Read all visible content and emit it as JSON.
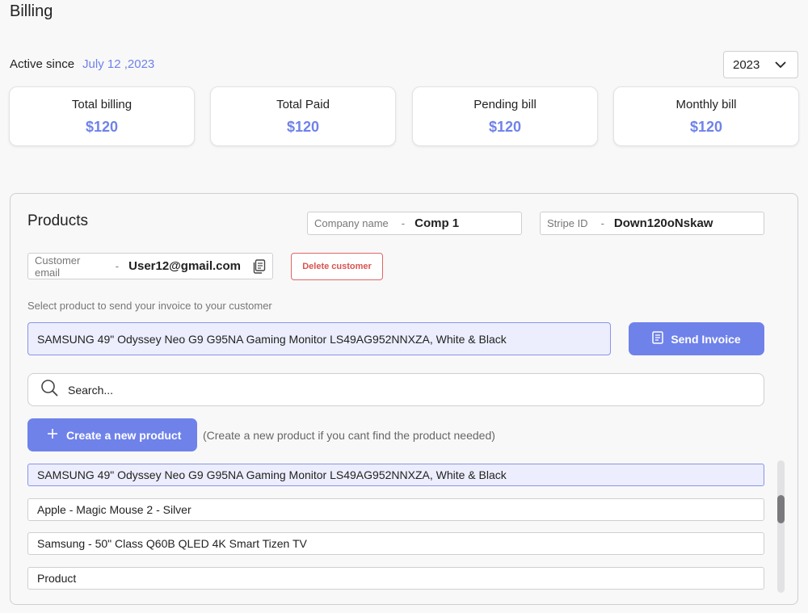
{
  "page": {
    "title": "Billing"
  },
  "account": {
    "active_label": "Active since",
    "active_date": "July 12 ,2023"
  },
  "year_select": {
    "value": "2023",
    "icon": "chevron-down-icon"
  },
  "stats": [
    {
      "title": "Total billing",
      "value": "$120"
    },
    {
      "title": "Total Paid",
      "value": "$120"
    },
    {
      "title": "Pending bill",
      "value": "$120"
    },
    {
      "title": "Monthly bill",
      "value": "$120"
    }
  ],
  "products": {
    "title": "Products",
    "company": {
      "label": "Company name",
      "sep": "-",
      "value": "Comp 1"
    },
    "stripe": {
      "label": "Stripe ID",
      "sep": "-",
      "value": "Down120oNskaw"
    },
    "customer_email": {
      "label": "Customer email",
      "sep": "-",
      "value": "User12@gmail.com"
    },
    "delete_label": "Delete customer",
    "hint": "Select product to send your invoice to your customer",
    "selected_product": "SAMSUNG 49\" Odyssey Neo G9 G95NA Gaming Monitor LS49AG952NNXZA, White & Black",
    "send_label": "Send Invoice",
    "search_placeholder": "Search...",
    "create_label": "Create a new product",
    "create_hint": "(Create a new product if you cant find the product needed)",
    "list": [
      "SAMSUNG 49\" Odyssey Neo G9 G95NA Gaming Monitor LS49AG952NNXZA, White & Black",
      "Apple - Magic Mouse 2 - Silver",
      "Samsung - 50\" Class Q60B QLED 4K Smart Tizen TV",
      "Product"
    ]
  },
  "colors": {
    "accent": "#6f82ea",
    "danger": "#d9534f",
    "selected_bg": "#eceefd"
  }
}
